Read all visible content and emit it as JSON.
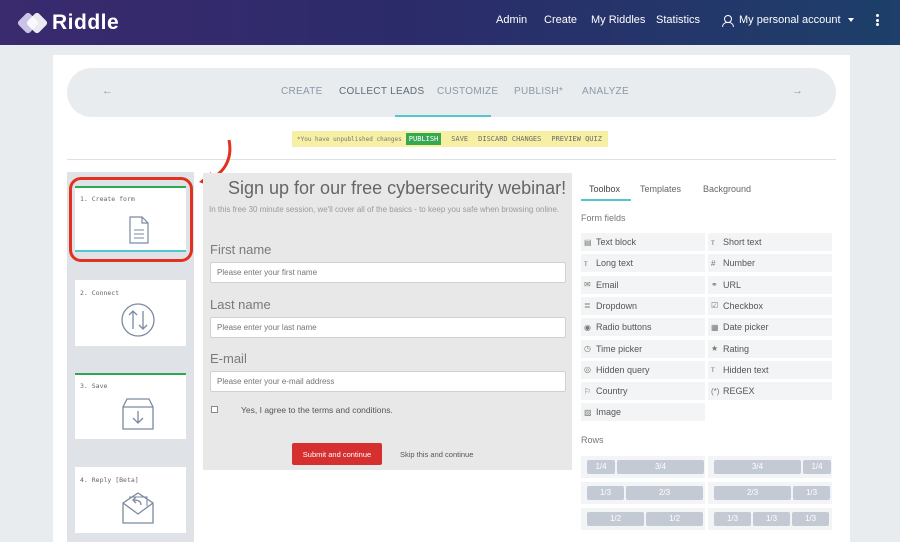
{
  "nav": {
    "logo": "Riddle",
    "links": [
      "Admin",
      "Create",
      "My Riddles",
      "Statistics"
    ],
    "account": "My personal account"
  },
  "steps": {
    "items": [
      "CREATE",
      "COLLECT LEADS",
      "CUSTOMIZE",
      "PUBLISH*",
      "ANALYZE"
    ],
    "active": "COLLECT LEADS"
  },
  "notice": {
    "message": "*You have unpublished changes",
    "publish": "PUBLISH",
    "save": "SAVE",
    "discard": "DISCARD CHANGES",
    "preview": "PREVIEW QUIZ"
  },
  "left_tiles": [
    "1. Create form",
    "2. Connect",
    "3. Save",
    "4. Reply [Beta]"
  ],
  "form": {
    "title": "Sign up for our free cybersecurity webinar!",
    "intro": "In this free 30 minute session, we'll cover all of the basics - to keep you safe when browsing online.",
    "fields": [
      {
        "label": "First name",
        "placeholder": "Please enter your first name"
      },
      {
        "label": "Last name",
        "placeholder": "Please enter your last name"
      },
      {
        "label": "E-mail",
        "placeholder": "Please enter your e-mail address"
      }
    ],
    "terms": "Yes, I agree to the terms and conditions.",
    "submit": "Submit and continue",
    "skip": "Skip this and continue"
  },
  "toolbox": {
    "tabs": [
      "Toolbox",
      "Templates",
      "Background"
    ],
    "form_fields_heading": "Form fields",
    "fields": [
      {
        "icon": "▤",
        "label": "Text block"
      },
      {
        "icon": "ᴛ",
        "label": "Short text"
      },
      {
        "icon": "ᴛ",
        "label": "Long text"
      },
      {
        "icon": "#",
        "label": "Number"
      },
      {
        "icon": "✉",
        "label": "Email"
      },
      {
        "icon": "⚭",
        "label": "URL"
      },
      {
        "icon": "≣",
        "label": "Dropdown"
      },
      {
        "icon": "☑",
        "label": "Checkbox"
      },
      {
        "icon": "◉",
        "label": "Radio buttons"
      },
      {
        "icon": "▦",
        "label": "Date picker"
      },
      {
        "icon": "◷",
        "label": "Time picker"
      },
      {
        "icon": "★",
        "label": "Rating"
      },
      {
        "icon": "◎",
        "label": "Hidden query"
      },
      {
        "icon": "ᴛ",
        "label": "Hidden text"
      },
      {
        "icon": "⚐",
        "label": "Country"
      },
      {
        "icon": "(*)",
        "label": "REGEX"
      },
      {
        "icon": "▨",
        "label": "Image"
      }
    ],
    "rows_heading": "Rows",
    "rows": [
      [
        "1/4",
        "3/4"
      ],
      [
        "3/4",
        "1/4"
      ],
      [
        "1/3",
        "2/3"
      ],
      [
        "2/3",
        "1/3"
      ],
      [
        "1/2",
        "1/2"
      ],
      [
        "1/3",
        "1/3",
        "1/3"
      ]
    ]
  }
}
